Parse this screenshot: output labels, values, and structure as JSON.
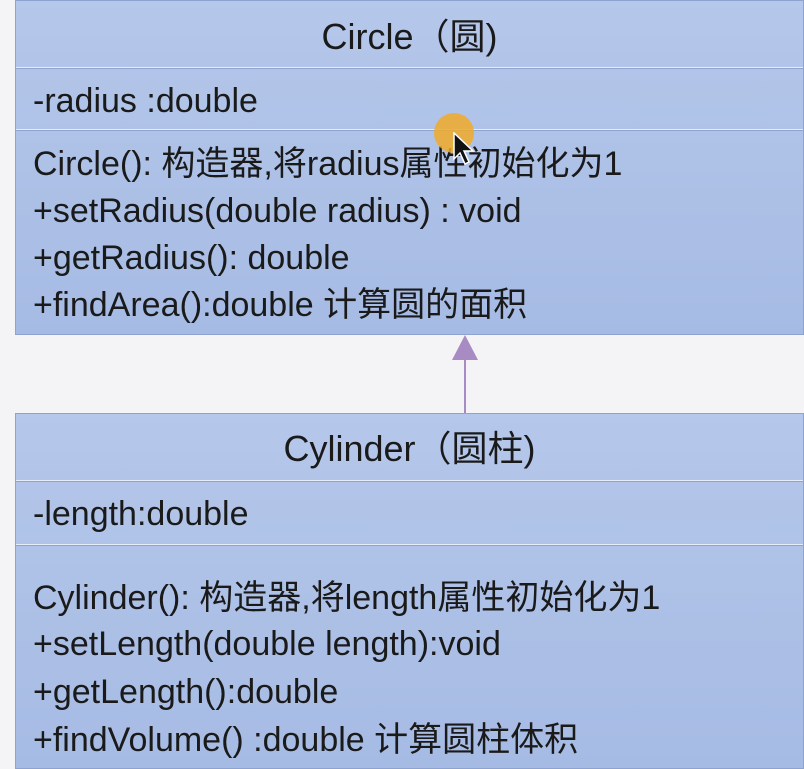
{
  "circle": {
    "title": "Circle（圆)",
    "attributes": [
      "-radius :double"
    ],
    "operations": [
      "Circle(): 构造器,将radius属性初始化为1",
      "+setRadius(double radius) : void",
      "+getRadius(): double",
      "+findArea():double  计算圆的面积"
    ]
  },
  "cylinder": {
    "title": "Cylinder（圆柱)",
    "attributes": [
      "-length:double"
    ],
    "operations": [
      "Cylinder():  构造器,将length属性初始化为1",
      "+setLength(double length):void",
      "+getLength():double",
      "+findVolume() :double   计算圆柱体积"
    ]
  },
  "colors": {
    "box_fill": "#a9bde6",
    "box_border": "#8ea3cf",
    "arrow": "#a98bc3",
    "cursor_highlight": "#f0aa28"
  },
  "icons": {
    "arrow": "inheritance-arrow-icon",
    "cursor": "mouse-pointer-icon"
  }
}
